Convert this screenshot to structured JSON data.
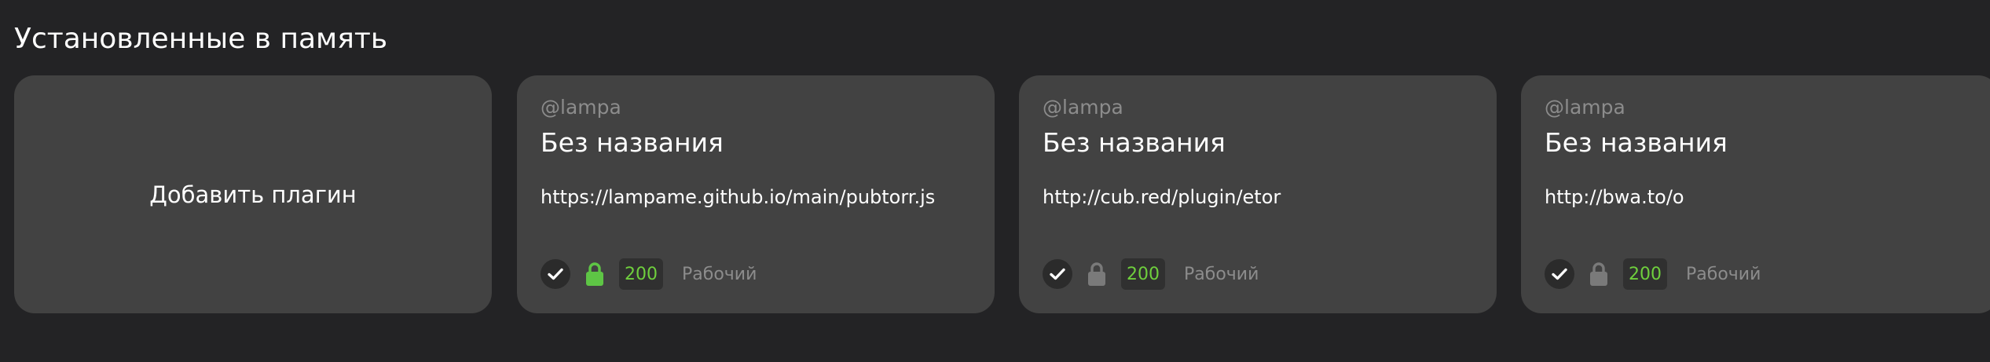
{
  "section": {
    "title": "Установленные в память"
  },
  "add_card": {
    "label": "Добавить плагин"
  },
  "plugins": [
    {
      "author": "@lampa",
      "name": "Без названия",
      "url": "https://lampame.github.io/main/pubtorr.js",
      "status_code": "200",
      "status_text": "Рабочий",
      "checked": true,
      "lock_state": "active",
      "lock_color": "#5ec545"
    },
    {
      "author": "@lampa",
      "name": "Без названия",
      "url": "http://cub.red/plugin/etor",
      "status_code": "200",
      "status_text": "Рабочий",
      "checked": true,
      "lock_state": "inactive",
      "lock_color": "#7a7a7a"
    },
    {
      "author": "@lampa",
      "name": "Без названия",
      "url": "http://bwa.to/o",
      "status_code": "200",
      "status_text": "Рабочий",
      "checked": true,
      "lock_state": "inactive",
      "lock_color": "#7a7a7a"
    }
  ],
  "colors": {
    "background": "#232325",
    "card": "#424242",
    "status_ok": "#6fcf3d",
    "muted_text": "#8c8c8c"
  }
}
